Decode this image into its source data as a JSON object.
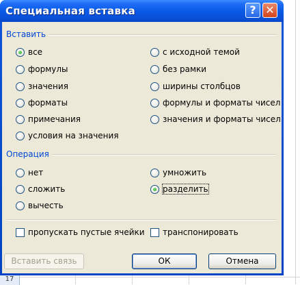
{
  "window": {
    "title": "Специальная вставка",
    "help_glyph": "?",
    "close_glyph": "✕"
  },
  "paste_group": {
    "label": "Вставить",
    "options": [
      {
        "label": "все",
        "checked": true
      },
      {
        "label": "формулы",
        "checked": false
      },
      {
        "label": "значения",
        "checked": false
      },
      {
        "label": "форматы",
        "checked": false
      },
      {
        "label": "примечания",
        "checked": false
      },
      {
        "label": "условия на значения",
        "checked": false
      },
      {
        "label": "с исходной темой",
        "checked": false
      },
      {
        "label": "без рамки",
        "checked": false
      },
      {
        "label": "ширины столбцов",
        "checked": false
      },
      {
        "label": "формулы и форматы чисел",
        "checked": false
      },
      {
        "label": "значения и форматы чисел",
        "checked": false
      }
    ]
  },
  "operation_group": {
    "label": "Операция",
    "options": [
      {
        "label": "нет",
        "checked": false
      },
      {
        "label": "сложить",
        "checked": false
      },
      {
        "label": "вычесть",
        "checked": false
      },
      {
        "label": "умножить",
        "checked": false
      },
      {
        "label": "разделить",
        "checked": true
      }
    ]
  },
  "checkboxes": {
    "skip_blanks": "пропускать пустые ячейки",
    "transpose": "транспонировать"
  },
  "buttons": {
    "paste_link": "Вставить связь",
    "ok": "ОК",
    "cancel": "Отмена"
  },
  "sheet": {
    "row_number": "17"
  }
}
